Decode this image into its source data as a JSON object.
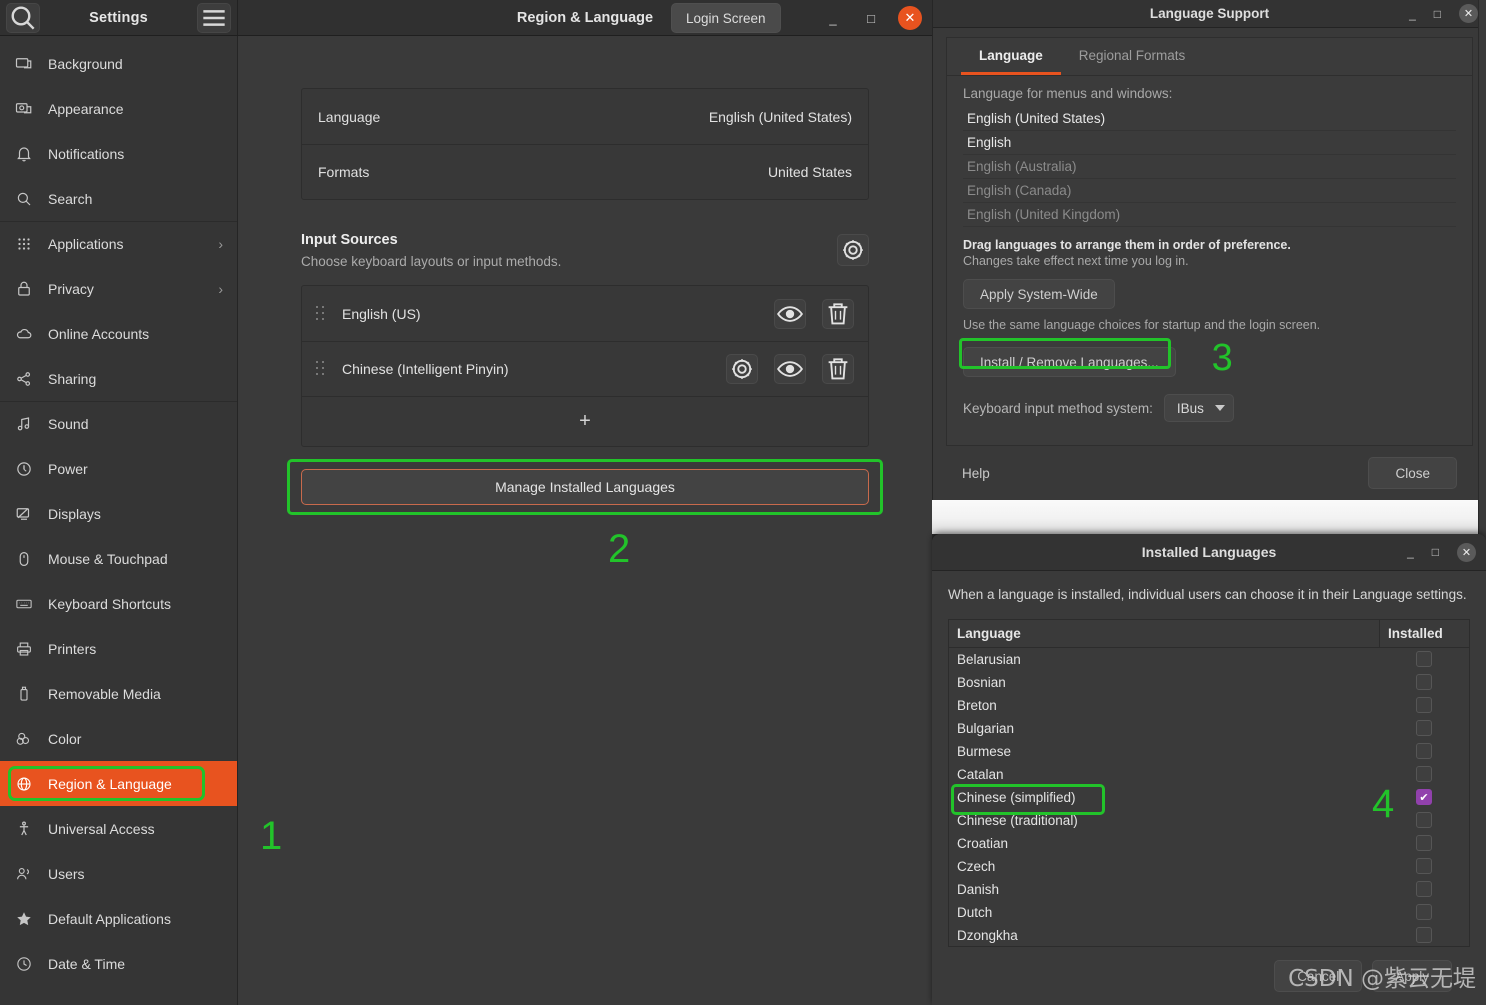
{
  "settings_window": {
    "title": "Settings",
    "panel_title": "Region & Language",
    "login_screen_button": "Login Screen",
    "search_icon": "search-icon",
    "menu_icon": "hamburger-menu-icon",
    "minimize": "_",
    "maximize": "□",
    "close": "✕",
    "sidebar": {
      "items": [
        {
          "label": "Background",
          "icon": "display-background-icon",
          "chevron": ""
        },
        {
          "label": "Appearance",
          "icon": "appearance-icon",
          "chevron": ""
        },
        {
          "label": "Notifications",
          "icon": "bell-icon",
          "chevron": ""
        },
        {
          "label": "Search",
          "icon": "search-icon",
          "chevron": ""
        },
        {
          "label": "Applications",
          "icon": "grid-apps-icon",
          "chevron": "›"
        },
        {
          "label": "Privacy",
          "icon": "lock-icon",
          "chevron": "›"
        },
        {
          "label": "Online Accounts",
          "icon": "cloud-icon",
          "chevron": ""
        },
        {
          "label": "Sharing",
          "icon": "share-nodes-icon",
          "chevron": ""
        },
        {
          "label": "Sound",
          "icon": "music-note-icon",
          "chevron": ""
        },
        {
          "label": "Power",
          "icon": "power-icon",
          "chevron": ""
        },
        {
          "label": "Displays",
          "icon": "monitor-icon",
          "chevron": ""
        },
        {
          "label": "Mouse & Touchpad",
          "icon": "mouse-icon",
          "chevron": ""
        },
        {
          "label": "Keyboard Shortcuts",
          "icon": "keyboard-icon",
          "chevron": ""
        },
        {
          "label": "Printers",
          "icon": "printer-icon",
          "chevron": ""
        },
        {
          "label": "Removable Media",
          "icon": "usb-drive-icon",
          "chevron": ""
        },
        {
          "label": "Color",
          "icon": "color-circles-icon",
          "chevron": ""
        },
        {
          "label": "Region & Language",
          "icon": "globe-icon",
          "chevron": ""
        },
        {
          "label": "Universal Access",
          "icon": "accessibility-icon",
          "chevron": ""
        },
        {
          "label": "Users",
          "icon": "users-icon",
          "chevron": ""
        },
        {
          "label": "Default Applications",
          "icon": "star-icon",
          "chevron": ""
        },
        {
          "label": "Date & Time",
          "icon": "clock-icon",
          "chevron": ""
        }
      ],
      "active_index": 16
    },
    "region_panel": {
      "rows": [
        {
          "label": "Language",
          "value": "English (United States)"
        },
        {
          "label": "Formats",
          "value": "United States"
        }
      ],
      "input_sources": {
        "title": "Input Sources",
        "subtitle": "Choose keyboard layouts or input methods.",
        "gear_icon": "settings-gear-icon",
        "sources": [
          {
            "name": "English (US)",
            "has_prefs": false,
            "preview_icon": "eye-icon",
            "remove_icon": "trash-icon"
          },
          {
            "name": "Chinese (Intelligent Pinyin)",
            "has_prefs": true,
            "prefs_icon": "settings-gear-icon",
            "preview_icon": "eye-icon",
            "remove_icon": "trash-icon"
          }
        ],
        "add_label": "+"
      },
      "manage_button": "Manage Installed Languages"
    }
  },
  "language_support_window": {
    "title": "Language Support",
    "minimize": "_",
    "maximize": "□",
    "close": "✕",
    "tabs": [
      {
        "label": "Language",
        "active": true
      },
      {
        "label": "Regional Formats",
        "active": false
      }
    ],
    "list_label": "Language for menus and windows:",
    "languages": [
      {
        "label": "English (United States)",
        "dim": false
      },
      {
        "label": "English",
        "dim": false
      },
      {
        "label": "English (Australia)",
        "dim": true
      },
      {
        "label": "English (Canada)",
        "dim": true
      },
      {
        "label": "English (United Kingdom)",
        "dim": true
      }
    ],
    "note_bold": "Drag languages to arrange them in order of preference.",
    "note": "Changes take effect next time you log in.",
    "apply_system_wide": "Apply System-Wide",
    "apply_hint": "Use the same language choices for startup and the login screen.",
    "install_remove": "Install / Remove Languages...",
    "keyboard_label": "Keyboard input method system:",
    "keyboard_value": "IBus",
    "help": "Help",
    "close_button": "Close"
  },
  "installed_languages_window": {
    "title": "Installed Languages",
    "minimize": "_",
    "maximize": "□",
    "close": "✕",
    "description": "When a language is installed, individual users can choose it in their Language settings.",
    "columns": {
      "language": "Language",
      "installed": "Installed"
    },
    "rows": [
      {
        "name": "Belarusian",
        "installed": false,
        "highlighted": false
      },
      {
        "name": "Bosnian",
        "installed": false,
        "highlighted": false
      },
      {
        "name": "Breton",
        "installed": false,
        "highlighted": false
      },
      {
        "name": "Bulgarian",
        "installed": false,
        "highlighted": false
      },
      {
        "name": "Burmese",
        "installed": false,
        "highlighted": false
      },
      {
        "name": "Catalan",
        "installed": false,
        "highlighted": false
      },
      {
        "name": "Chinese (simplified)",
        "installed": true,
        "highlighted": true
      },
      {
        "name": "Chinese (traditional)",
        "installed": false,
        "highlighted": false
      },
      {
        "name": "Croatian",
        "installed": false,
        "highlighted": false
      },
      {
        "name": "Czech",
        "installed": false,
        "highlighted": false
      },
      {
        "name": "Danish",
        "installed": false,
        "highlighted": false
      },
      {
        "name": "Dutch",
        "installed": false,
        "highlighted": false
      },
      {
        "name": "Dzongkha",
        "installed": false,
        "highlighted": false
      }
    ],
    "cancel": "Cancel",
    "apply": "Apply",
    "check_glyph": "✔"
  },
  "annotations": [
    {
      "id": "1",
      "text": "1"
    },
    {
      "id": "2",
      "text": "2"
    },
    {
      "id": "3",
      "text": "3"
    },
    {
      "id": "4",
      "text": "4"
    }
  ],
  "watermark": "CSDN @紫云无堤",
  "colors": {
    "accent_orange": "#e8531f",
    "highlight_green": "#22c32a",
    "checkbox_purple": "#9141ac",
    "window_bg": "#3a3a3a",
    "titlebar_bg": "#333333"
  }
}
